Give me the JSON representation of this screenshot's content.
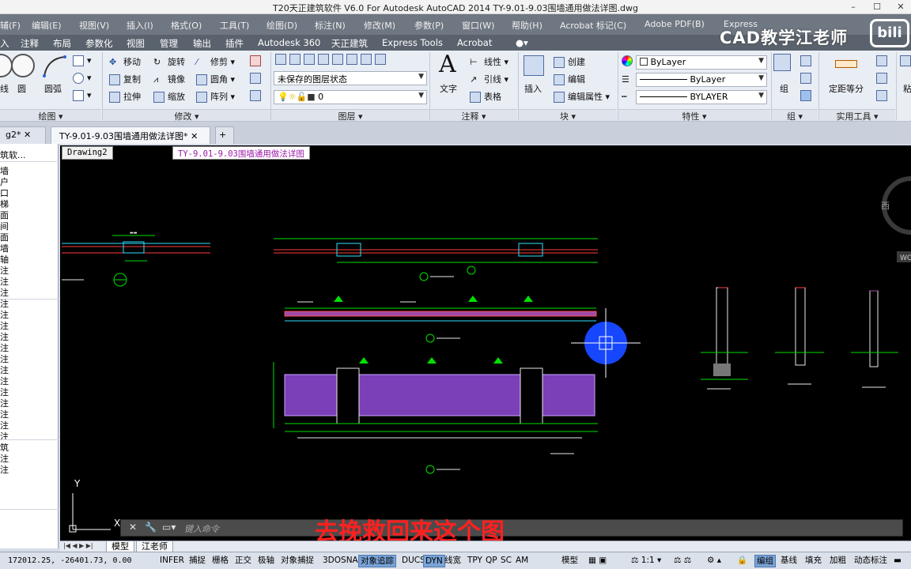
{
  "window": {
    "title": "T20天正建筑软件 V6.0 For Autodesk AutoCAD 2014     TY-9.01-9.03围墙通用做法详图.dwg"
  },
  "menu_row1": [
    "辅(F)",
    "编辑(E)",
    "视图(V)",
    "插入(I)",
    "格式(O)",
    "工具(T)",
    "绘图(D)",
    "标注(N)",
    "修改(M)",
    "参数(P)",
    "窗口(W)",
    "帮助(H)",
    "Acrobat 标记(C)",
    "Adobe PDF(B)",
    "Express"
  ],
  "ribbon_tabs": [
    "入",
    "注释",
    "布局",
    "参数化",
    "视图",
    "管理",
    "输出",
    "插件",
    "Autodesk 360",
    "天正建筑",
    "Express Tools",
    "Acrobat"
  ],
  "watermark": "CAD教学江老师",
  "ribbon": {
    "draw": {
      "caption": "绘图 ▾",
      "line": "线",
      "circle": "圆",
      "arc": "圆弧"
    },
    "modify": {
      "caption": "修改 ▾",
      "rows": [
        [
          "移动",
          "旋转",
          "修剪"
        ],
        [
          "复制",
          "镜像",
          "圆角"
        ],
        [
          "拉伸",
          "缩放",
          "阵列"
        ]
      ]
    },
    "layers": {
      "caption": "图层 ▾",
      "state": "未保存的图层状态",
      "current": "0"
    },
    "annotation": {
      "caption": "注释 ▾",
      "text": "文字",
      "linear": "线性",
      "leader": "引线",
      "table": "表格"
    },
    "block": {
      "caption": "块 ▾",
      "insert": "插入",
      "create": "创建",
      "edit": "编辑",
      "edit_attr": "编辑属性"
    },
    "properties": {
      "caption": "特性 ▾",
      "color": "ByLayer",
      "linetype": "ByLayer",
      "lineweight": "BYLAYER"
    },
    "group": {
      "caption": "组 ▾",
      "label": "组"
    },
    "utilities": {
      "caption": "实用工具 ▾",
      "measure": "定距等分"
    },
    "clipboard": {
      "label": "粘"
    }
  },
  "doc_tabs": [
    "g2*",
    "TY-9.01-9.03围墙通用做法详图*"
  ],
  "layout_tabs_top": [
    "Drawing2",
    "TY-9.01-9.03围墙通用做法详图"
  ],
  "palette": {
    "title": "筑软...",
    "items": [
      "墙",
      "户",
      "口",
      "梯",
      "面",
      "间",
      "面",
      "墙",
      "轴",
      "注",
      "注",
      "注",
      "注",
      "注",
      "注",
      "注",
      "注",
      "注",
      "注",
      "注",
      "注",
      "注",
      "注",
      "注",
      "注",
      "筑",
      "注",
      "注"
    ]
  },
  "viewcube": {
    "west": "西",
    "wcs": "WC"
  },
  "ucs": {
    "y": "Y"
  },
  "command": {
    "placeholder": "键入命令"
  },
  "subtitle": "去挽救回来这个图",
  "layout_tabs": [
    "模型",
    "江老师"
  ],
  "status": {
    "coords": "172012.25,  -26401.73, 0.00",
    "toggles": [
      {
        "label": "INFER",
        "on": false
      },
      {
        "label": "捕捉",
        "on": false
      },
      {
        "label": "栅格",
        "on": false
      },
      {
        "label": "正交",
        "on": false
      },
      {
        "label": "极轴",
        "on": false
      },
      {
        "label": "对象捕捉",
        "on": false
      },
      {
        "label": "3DOSNAP",
        "on": false
      },
      {
        "label": "对象追踪",
        "on": true
      },
      {
        "label": "DUCS",
        "on": false
      },
      {
        "label": "DYN",
        "on": true
      },
      {
        "label": "线宽",
        "on": false
      },
      {
        "label": "TPY",
        "on": false
      },
      {
        "label": "QP",
        "on": false
      },
      {
        "label": "SC",
        "on": false
      },
      {
        "label": "AM",
        "on": false
      }
    ],
    "model": "模型",
    "scale": "1:1 ▾",
    "right": [
      {
        "label": "编组",
        "on": true
      },
      {
        "label": "基线",
        "on": false
      },
      {
        "label": "填充",
        "on": false
      },
      {
        "label": "加粗",
        "on": false
      },
      {
        "label": "动态标注",
        "on": false
      }
    ]
  }
}
